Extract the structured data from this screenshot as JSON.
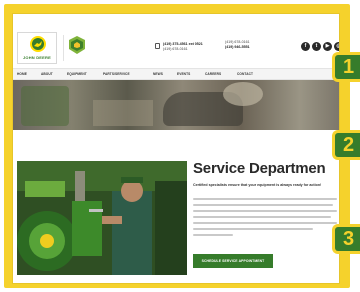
{
  "header": {
    "brand_word": "JOHN DEERE",
    "phone_1_label": "",
    "phone_1": "(419) 375-4561 ext 0521",
    "phone_1_line2": "(419) 678-0161",
    "phone_2_label": "",
    "phone_2": "(419) 678-0161",
    "phone_2_line2": "(419) 946-5551",
    "social": [
      {
        "icon": "facebook-icon",
        "glyph": "f"
      },
      {
        "icon": "twitter-icon",
        "glyph": "t"
      },
      {
        "icon": "youtube-icon",
        "glyph": "▶"
      },
      {
        "icon": "instagram-icon",
        "glyph": "◎"
      }
    ]
  },
  "nav": {
    "items": [
      "HOME",
      "ABOUT",
      "EQUIPMENT",
      "PARTS/SERVICE",
      "NEWS",
      "EVENTS",
      "CAREERS",
      "CONTACT"
    ]
  },
  "service": {
    "title": "Service Departmen",
    "subtitle": "Certified specialists ensure that your equipment is always ready for action!",
    "cta_label": "SCHEDULE SERVICE APPOINTMENT"
  },
  "steps": [
    "1",
    "2",
    "3"
  ],
  "colors": {
    "frame": "#f5d22c",
    "jd_green": "#367c2b",
    "jd_yellow": "#ffde00"
  }
}
